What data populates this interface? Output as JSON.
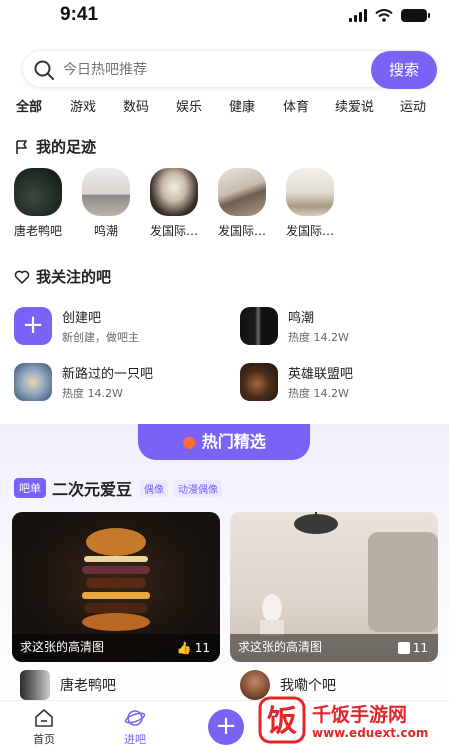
{
  "status": {
    "time": "9:41"
  },
  "search": {
    "placeholder": "今日热吧推荐",
    "button_label": "搜索"
  },
  "categories": [
    "全部",
    "游戏",
    "数码",
    "娱乐",
    "健康",
    "体育",
    "续爱说",
    "运动"
  ],
  "footprints": {
    "title": "我的足迹",
    "items": [
      {
        "label": "唐老鸭吧"
      },
      {
        "label": "鸣潮"
      },
      {
        "label": "发国际…"
      },
      {
        "label": "发国际…"
      },
      {
        "label": "发国际…"
      }
    ]
  },
  "followed": {
    "title": "我关注的吧",
    "items": [
      {
        "name": "创建吧",
        "sub": "新创建，做吧主"
      },
      {
        "name": "鸣潮",
        "sub": "热度 14.2W"
      },
      {
        "name": "新路过的一只吧",
        "sub": "热度 14.2W"
      },
      {
        "name": "英雄联盟吧",
        "sub": "热度 14.2W"
      }
    ]
  },
  "hot": {
    "tab_label": "热门精选",
    "list_tag": "吧单",
    "list_title": "二次元爱豆",
    "tags": [
      "偶像",
      "动漫偶像"
    ],
    "cards": [
      {
        "caption": "求这张的高清图",
        "likes": "11",
        "author": "唐老鸭吧"
      },
      {
        "caption": "求这张的高清图",
        "likes": "11",
        "author": "我嘞个吧"
      }
    ]
  },
  "tabbar": {
    "home": "首页",
    "bar": "进吧"
  },
  "watermark": {
    "text": "千饭手游网",
    "url": "www.eduext.com"
  },
  "colors": {
    "accent": "#7b62f5",
    "watermark": "#e3262a"
  }
}
